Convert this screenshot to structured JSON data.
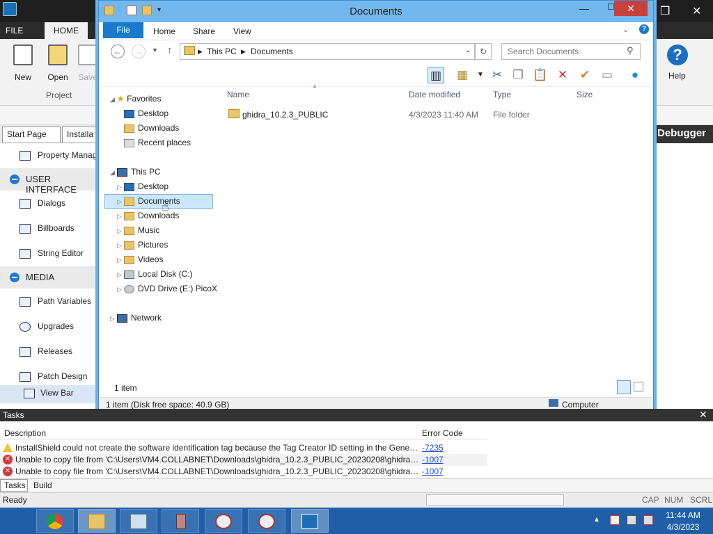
{
  "app": {
    "ribbon_tabs": {
      "file": "FILE",
      "home": "HOME"
    },
    "buttons": {
      "new": "New",
      "open": "Open",
      "save": "Save",
      "help": "Help"
    },
    "group_project": "Project",
    "doc_tabs": {
      "start_page": "Start Page",
      "installation": "Installa"
    },
    "debugger_label": "Debugger",
    "sidebar": {
      "property_manager": "Property Manag",
      "user_interface": "USER INTERFACE",
      "dialogs": "Dialogs",
      "billboards": "Billboards",
      "string_editor": "String Editor",
      "media": "MEDIA",
      "path_variables": "Path Variables",
      "upgrades": "Upgrades",
      "releases": "Releases",
      "patch_design": "Patch Design",
      "view_bar": "View Bar"
    }
  },
  "explorer": {
    "title": "Documents",
    "tabs": {
      "file": "File",
      "home": "Home",
      "share": "Share",
      "view": "View"
    },
    "breadcrumb": {
      "this_pc": "This PC",
      "documents": "Documents"
    },
    "search_placeholder": "Search Documents",
    "nav": {
      "favorites": "Favorites",
      "desktop": "Desktop",
      "downloads": "Downloads",
      "recent_places": "Recent places",
      "this_pc": "This PC",
      "pc_desktop": "Desktop",
      "pc_documents": "Documents",
      "pc_downloads": "Downloads",
      "music": "Music",
      "pictures": "Pictures",
      "videos": "Videos",
      "local_disk": "Local Disk (C:)",
      "dvd_drive": "DVD Drive (E:) PicoX",
      "network": "Network"
    },
    "columns": {
      "name": "Name",
      "date_modified": "Date modified",
      "type": "Type",
      "size": "Size"
    },
    "files": [
      {
        "name": "ghidra_10.2.3_PUBLIC",
        "date": "4/3/2023 11:40 AM",
        "type": "File folder"
      }
    ],
    "item_count": "1 item",
    "status": "1 item (Disk free space: 40.9 GB)",
    "computer": "Computer"
  },
  "tasks": {
    "title": "Tasks",
    "columns": {
      "description": "Description",
      "error_code": "Error Code"
    },
    "rows": [
      {
        "severity": "warning",
        "text": "InstallShield could not create the software identification tag because the Tag Creator ID setting in the General...",
        "code": "-7235"
      },
      {
        "severity": "error",
        "text": "Unable to copy file from 'C:\\Users\\VM4.COLLABNET\\Downloads\\ghidra_10.2.3_PUBLIC_20230208\\ghidra_10.2.3...",
        "code": "-1007"
      },
      {
        "severity": "error",
        "text": "Unable to copy file from 'C:\\Users\\VM4.COLLABNET\\Downloads\\ghidra_10.2.3_PUBLIC_20230208\\ghidra_10.2.3...",
        "code": "-1007"
      }
    ],
    "bottom_tabs": {
      "tasks": "Tasks",
      "build": "Build"
    }
  },
  "statusbar": {
    "ready": "Ready",
    "cap": "CAP",
    "num": "NUM",
    "scrl": "SCRL"
  },
  "taskbar": {
    "time": "11:44 AM",
    "date": "4/3/2023"
  }
}
